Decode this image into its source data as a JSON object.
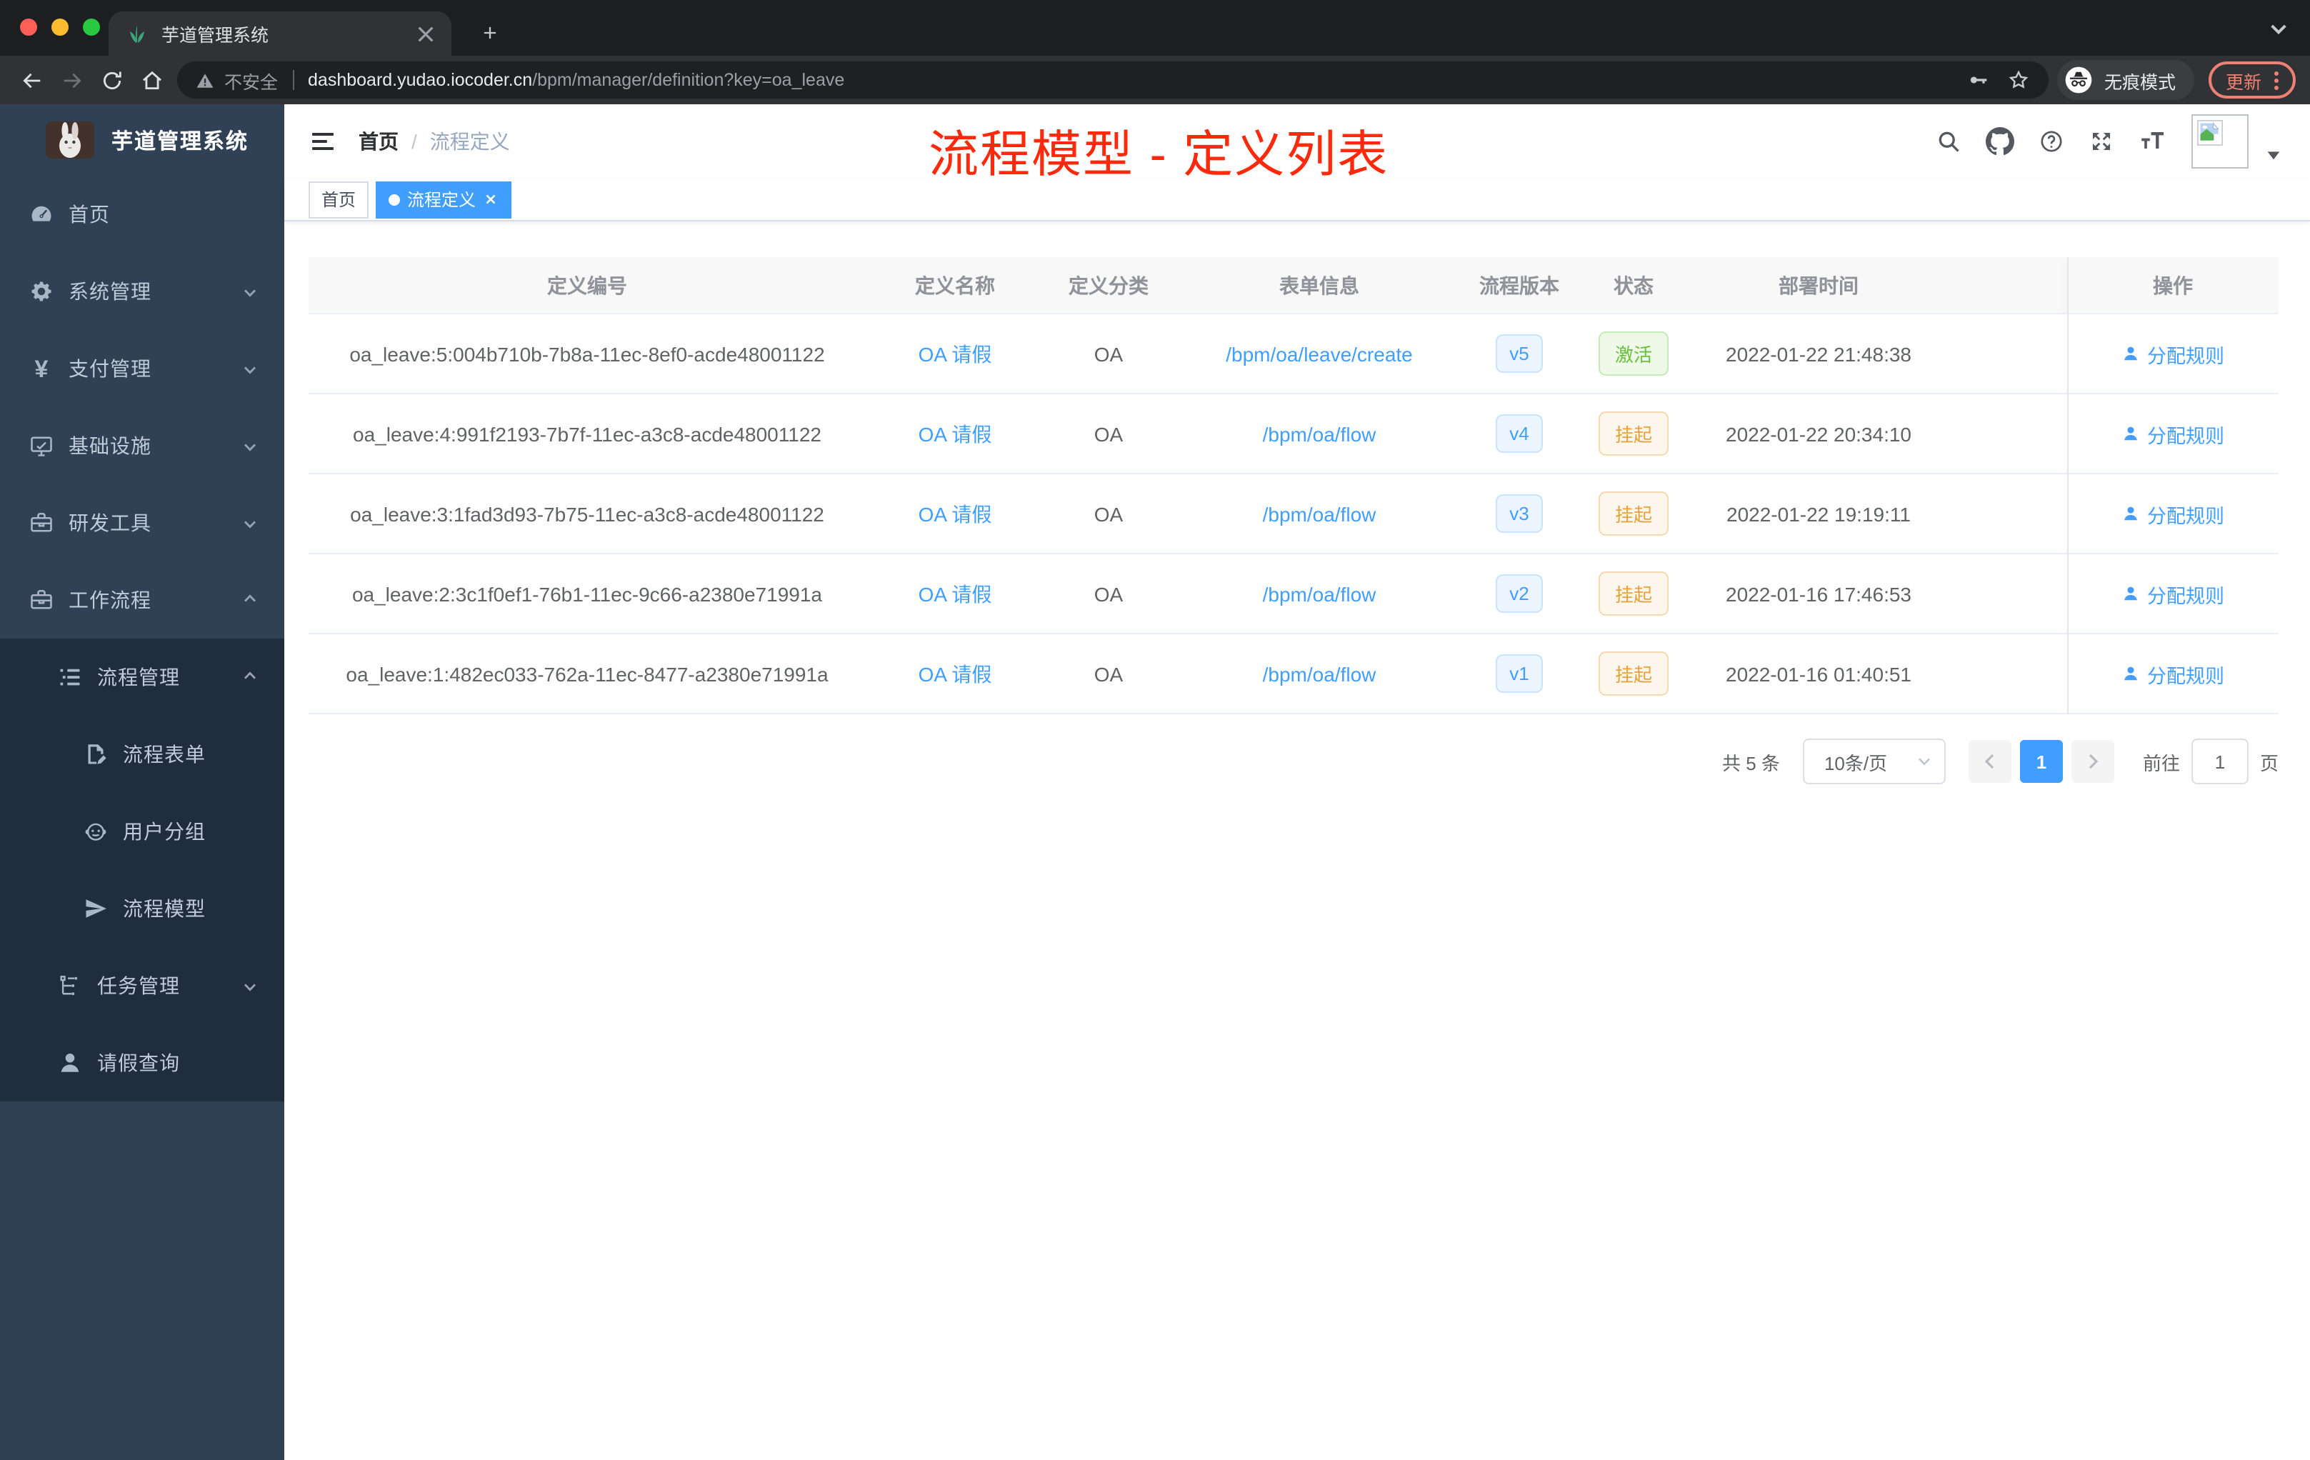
{
  "colors": {
    "accent": "#409eff",
    "annot": "#fb2a0c",
    "sidebar": "#304156",
    "sidebar-dark": "#1f2d3d",
    "sidebar-text": "#bfcbd9"
  },
  "browser": {
    "tab_title": "芋道管理系统",
    "security_label": "不安全",
    "url_host": "dashboard.yudao.iocoder.cn",
    "url_path": "/bpm/manager/definition?key=oa_leave",
    "incognito_label": "无痕模式",
    "update_label": "更新"
  },
  "sidebar": {
    "logo_title": "芋道管理系统",
    "menu": [
      {
        "key": "home",
        "label": "首页",
        "icon": "dashboard-icon",
        "level": 0,
        "chevron": null,
        "dark": false
      },
      {
        "key": "system",
        "label": "系统管理",
        "icon": "gear-icon",
        "level": 0,
        "chevron": "down",
        "dark": false
      },
      {
        "key": "payment",
        "label": "支付管理",
        "icon": "yen-icon",
        "level": 0,
        "chevron": "down",
        "dark": false
      },
      {
        "key": "infrastructure",
        "label": "基础设施",
        "icon": "monitor-icon",
        "level": 0,
        "chevron": "down",
        "dark": false
      },
      {
        "key": "dev-tools",
        "label": "研发工具",
        "icon": "toolbox-icon",
        "level": 0,
        "chevron": "down",
        "dark": false
      },
      {
        "key": "workflow",
        "label": "工作流程",
        "icon": "briefcase-icon",
        "level": 0,
        "chevron": "up",
        "dark": false
      },
      {
        "key": "process-manage",
        "label": "流程管理",
        "icon": "tree-list-icon",
        "level": 1,
        "chevron": "up",
        "dark": true
      },
      {
        "key": "process-form",
        "label": "流程表单",
        "icon": "form-icon",
        "level": 2,
        "chevron": null,
        "dark": true
      },
      {
        "key": "user-group",
        "label": "用户分组",
        "icon": "robot-icon",
        "level": 2,
        "chevron": null,
        "dark": true
      },
      {
        "key": "process-model",
        "label": "流程模型",
        "icon": "paper-plane-icon",
        "level": 2,
        "chevron": null,
        "dark": true
      },
      {
        "key": "task-manage",
        "label": "任务管理",
        "icon": "branch-icon",
        "level": 1,
        "chevron": "down",
        "dark": true
      },
      {
        "key": "leave-query",
        "label": "请假查询",
        "icon": "user-icon",
        "level": 1,
        "chevron": null,
        "dark": true
      }
    ]
  },
  "navbar": {
    "breadcrumb_home": "首页",
    "breadcrumb_sep": "/",
    "breadcrumb_current": "流程定义",
    "annotation": "流程模型 - 定义列表"
  },
  "tags": [
    {
      "label": "首页",
      "active": false,
      "closable": false
    },
    {
      "label": "流程定义",
      "active": true,
      "closable": true
    }
  ],
  "table": {
    "columns": [
      "定义编号",
      "定义名称",
      "定义分类",
      "表单信息",
      "流程版本",
      "状态",
      "部署时间",
      "操作"
    ],
    "action_label": "分配规则",
    "rows": [
      {
        "id": "oa_leave:5:004b710b-7b8a-11ec-8ef0-acde48001122",
        "name": "OA 请假",
        "category": "OA",
        "form": "/bpm/oa/leave/create",
        "version": "v5",
        "status": "激活",
        "status_type": "success",
        "time": "2022-01-22 21:48:38"
      },
      {
        "id": "oa_leave:4:991f2193-7b7f-11ec-a3c8-acde48001122",
        "name": "OA 请假",
        "category": "OA",
        "form": "/bpm/oa/flow",
        "version": "v4",
        "status": "挂起",
        "status_type": "warning",
        "time": "2022-01-22 20:34:10"
      },
      {
        "id": "oa_leave:3:1fad3d93-7b75-11ec-a3c8-acde48001122",
        "name": "OA 请假",
        "category": "OA",
        "form": "/bpm/oa/flow",
        "version": "v3",
        "status": "挂起",
        "status_type": "warning",
        "time": "2022-01-22 19:19:11"
      },
      {
        "id": "oa_leave:2:3c1f0ef1-76b1-11ec-9c66-a2380e71991a",
        "name": "OA 请假",
        "category": "OA",
        "form": "/bpm/oa/flow",
        "version": "v2",
        "status": "挂起",
        "status_type": "warning",
        "time": "2022-01-16 17:46:53"
      },
      {
        "id": "oa_leave:1:482ec033-762a-11ec-8477-a2380e71991a",
        "name": "OA 请假",
        "category": "OA",
        "form": "/bpm/oa/flow",
        "version": "v1",
        "status": "挂起",
        "status_type": "warning",
        "time": "2022-01-16 01:40:51"
      }
    ]
  },
  "pagination": {
    "total": "共 5 条",
    "page_size": "10条/页",
    "current_page": "1",
    "goto_label": "前往",
    "goto_value": "1",
    "page_suffix": "页"
  }
}
